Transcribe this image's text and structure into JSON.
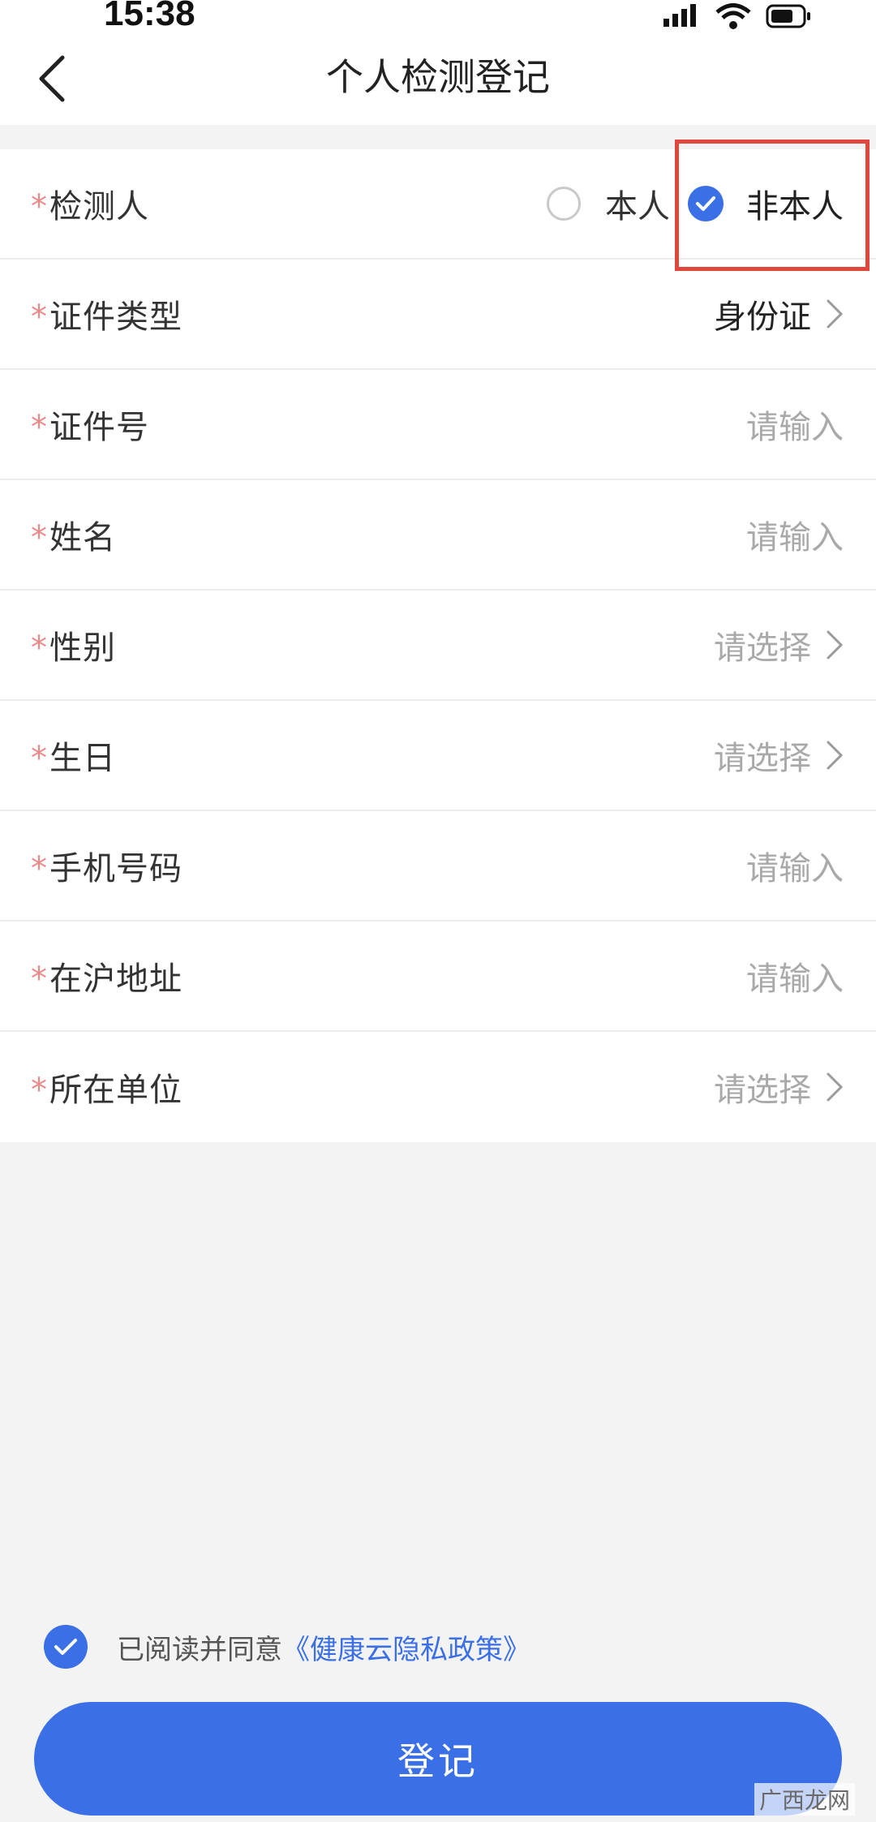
{
  "status_bar": {
    "time": "15:38"
  },
  "nav": {
    "title": "个人检测登记"
  },
  "form": {
    "tester": {
      "label": "检测人",
      "option_self": "本人",
      "option_other": "非本人",
      "selected": "非本人"
    },
    "rows": [
      {
        "label": "证件类型",
        "value": "身份证"
      },
      {
        "label": "证件号",
        "value": "请输入"
      },
      {
        "label": "姓名",
        "value": "请输入"
      },
      {
        "label": "性别",
        "value": "请选择"
      },
      {
        "label": "生日",
        "value": "请选择"
      },
      {
        "label": "手机号码",
        "value": "请输入"
      },
      {
        "label": "在沪地址",
        "value": "请输入"
      },
      {
        "label": "所在单位",
        "value": "请选择"
      }
    ],
    "required_mark": "*"
  },
  "agreement": {
    "prefix": "已阅读并同意",
    "link": "《健康云隐私政策》",
    "checked": true
  },
  "submit": {
    "label": "登记"
  },
  "watermark": "广西龙网",
  "colors": {
    "accent": "#3a6fe6",
    "required": "#e98a8a",
    "highlight": "#e0473c"
  }
}
